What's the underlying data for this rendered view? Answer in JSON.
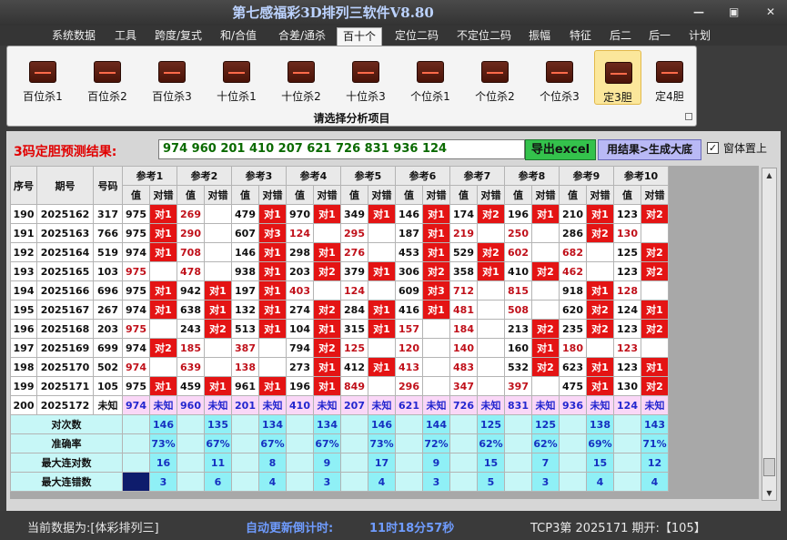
{
  "window": {
    "title": "第七感福彩3D排列三软件V8.80",
    "min_icon": "minimize-icon",
    "max_icon": "maximize-icon",
    "close_icon": "close-icon"
  },
  "menu": [
    "系统数据",
    "工具",
    "跨度/复式",
    "和/合值",
    "合差/通杀",
    "百十个",
    "定位二码",
    "不定位二码",
    "振幅",
    "特征",
    "后二",
    "后一",
    "计划"
  ],
  "menu_active": "百十个",
  "ribbon": {
    "buttons": [
      "百位杀1",
      "百位杀2",
      "百位杀3",
      "十位杀1",
      "十位杀2",
      "十位杀3",
      "个位杀1",
      "个位杀2",
      "个位杀3",
      "定3胆",
      "定4胆"
    ],
    "active": "定3胆",
    "icon": "chart-icon",
    "caption": "请选择分析项目"
  },
  "result": {
    "label": "3码定胆预测结果:",
    "value": "974 960 201 410 207 621 726 831 936 124",
    "export_button": "导出excel",
    "generate_button": "用结果>生成大底",
    "topmost_label": "窗体置上",
    "topmost_checked": true
  },
  "table": {
    "header_row1": [
      "序号",
      "期号",
      "号码",
      "参考1",
      "参考2",
      "参考3",
      "参考4",
      "参考5",
      "参考6",
      "参考7",
      "参考8",
      "参考9",
      "参考10"
    ],
    "sub_value": "值",
    "sub_match": "对错",
    "rows": [
      {
        "seq": "190",
        "issue": "2025162",
        "num": "317",
        "refs": [
          [
            "975",
            "对1"
          ],
          [
            "269",
            ""
          ],
          [
            "479",
            "对1"
          ],
          [
            "970",
            "对1"
          ],
          [
            "349",
            "对1"
          ],
          [
            "146",
            "对1"
          ],
          [
            "174",
            "对2"
          ],
          [
            "196",
            "对1"
          ],
          [
            "210",
            "对1"
          ],
          [
            "123",
            "对2"
          ]
        ]
      },
      {
        "seq": "191",
        "issue": "2025163",
        "num": "766",
        "refs": [
          [
            "975",
            "对1"
          ],
          [
            "290",
            ""
          ],
          [
            "607",
            "对3"
          ],
          [
            "124",
            ""
          ],
          [
            "295",
            ""
          ],
          [
            "187",
            "对1"
          ],
          [
            "219",
            ""
          ],
          [
            "250",
            ""
          ],
          [
            "286",
            "对2"
          ],
          [
            "130",
            ""
          ]
        ]
      },
      {
        "seq": "192",
        "issue": "2025164",
        "num": "519",
        "refs": [
          [
            "974",
            "对1"
          ],
          [
            "708",
            ""
          ],
          [
            "146",
            "对1"
          ],
          [
            "298",
            "对1"
          ],
          [
            "276",
            ""
          ],
          [
            "453",
            "对1"
          ],
          [
            "529",
            "对2"
          ],
          [
            "602",
            ""
          ],
          [
            "682",
            ""
          ],
          [
            "125",
            "对2"
          ]
        ]
      },
      {
        "seq": "193",
        "issue": "2025165",
        "num": "103",
        "refs": [
          [
            "975",
            ""
          ],
          [
            "478",
            ""
          ],
          [
            "938",
            "对1"
          ],
          [
            "203",
            "对2"
          ],
          [
            "379",
            "对1"
          ],
          [
            "306",
            "对2"
          ],
          [
            "358",
            "对1"
          ],
          [
            "410",
            "对2"
          ],
          [
            "462",
            ""
          ],
          [
            "123",
            "对2"
          ]
        ]
      },
      {
        "seq": "194",
        "issue": "2025166",
        "num": "696",
        "refs": [
          [
            "975",
            "对1"
          ],
          [
            "942",
            "对1"
          ],
          [
            "197",
            "对1"
          ],
          [
            "403",
            ""
          ],
          [
            "124",
            ""
          ],
          [
            "609",
            "对3"
          ],
          [
            "712",
            ""
          ],
          [
            "815",
            ""
          ],
          [
            "918",
            "对1"
          ],
          [
            "128",
            ""
          ]
        ]
      },
      {
        "seq": "195",
        "issue": "2025167",
        "num": "267",
        "refs": [
          [
            "974",
            "对1"
          ],
          [
            "638",
            "对1"
          ],
          [
            "132",
            "对1"
          ],
          [
            "274",
            "对2"
          ],
          [
            "284",
            "对1"
          ],
          [
            "416",
            "对1"
          ],
          [
            "481",
            ""
          ],
          [
            "508",
            ""
          ],
          [
            "620",
            "对2"
          ],
          [
            "124",
            "对1"
          ]
        ]
      },
      {
        "seq": "196",
        "issue": "2025168",
        "num": "203",
        "refs": [
          [
            "975",
            ""
          ],
          [
            "243",
            "对2"
          ],
          [
            "513",
            "对1"
          ],
          [
            "104",
            "对1"
          ],
          [
            "315",
            "对1"
          ],
          [
            "157",
            ""
          ],
          [
            "184",
            ""
          ],
          [
            "213",
            "对2"
          ],
          [
            "235",
            "对2"
          ],
          [
            "123",
            "对2"
          ]
        ]
      },
      {
        "seq": "197",
        "issue": "2025169",
        "num": "699",
        "refs": [
          [
            "974",
            "对2"
          ],
          [
            "185",
            ""
          ],
          [
            "387",
            ""
          ],
          [
            "794",
            "对2"
          ],
          [
            "125",
            ""
          ],
          [
            "120",
            ""
          ],
          [
            "140",
            ""
          ],
          [
            "160",
            "对1"
          ],
          [
            "180",
            ""
          ],
          [
            "123",
            ""
          ]
        ]
      },
      {
        "seq": "198",
        "issue": "2025170",
        "num": "502",
        "refs": [
          [
            "974",
            ""
          ],
          [
            "639",
            ""
          ],
          [
            "138",
            ""
          ],
          [
            "273",
            "对1"
          ],
          [
            "412",
            "对1"
          ],
          [
            "413",
            ""
          ],
          [
            "483",
            ""
          ],
          [
            "532",
            "对2"
          ],
          [
            "623",
            "对1"
          ],
          [
            "123",
            "对1"
          ]
        ]
      },
      {
        "seq": "199",
        "issue": "2025171",
        "num": "105",
        "refs": [
          [
            "975",
            "对1"
          ],
          [
            "459",
            "对1"
          ],
          [
            "961",
            "对1"
          ],
          [
            "196",
            "对1"
          ],
          [
            "849",
            ""
          ],
          [
            "296",
            ""
          ],
          [
            "347",
            ""
          ],
          [
            "397",
            ""
          ],
          [
            "475",
            "对1"
          ],
          [
            "130",
            "对2"
          ]
        ]
      }
    ],
    "pending": {
      "seq": "200",
      "issue": "2025172",
      "num": "未知",
      "values": [
        "974",
        "960",
        "201",
        "410",
        "207",
        "621",
        "726",
        "831",
        "936",
        "124"
      ],
      "mark": "未知"
    },
    "stats": [
      {
        "label": "对次数",
        "values": [
          "146",
          "135",
          "134",
          "134",
          "146",
          "144",
          "125",
          "125",
          "138",
          "143"
        ]
      },
      {
        "label": "准确率",
        "values": [
          "73%",
          "67%",
          "67%",
          "67%",
          "73%",
          "72%",
          "62%",
          "62%",
          "69%",
          "71%"
        ]
      },
      {
        "label": "最大连对数",
        "values": [
          "16",
          "11",
          "8",
          "9",
          "17",
          "9",
          "15",
          "7",
          "15",
          "12"
        ]
      },
      {
        "label": "最大连错数",
        "values": [
          "3",
          "6",
          "4",
          "3",
          "4",
          "3",
          "5",
          "3",
          "4",
          "4"
        ]
      }
    ]
  },
  "status": {
    "current_data": "当前数据为:[体彩排列三]",
    "countdown_label": "自动更新倒计时:",
    "countdown_value": "11时18分57秒",
    "issue_info": "TCP3第 2025171 期开:【105】"
  },
  "colors": {
    "red_cell": "#e41414",
    "pink_row": "#fad7f7",
    "cyan_stat": "#8ff0f6",
    "accent_title": "#bcd3ff"
  }
}
